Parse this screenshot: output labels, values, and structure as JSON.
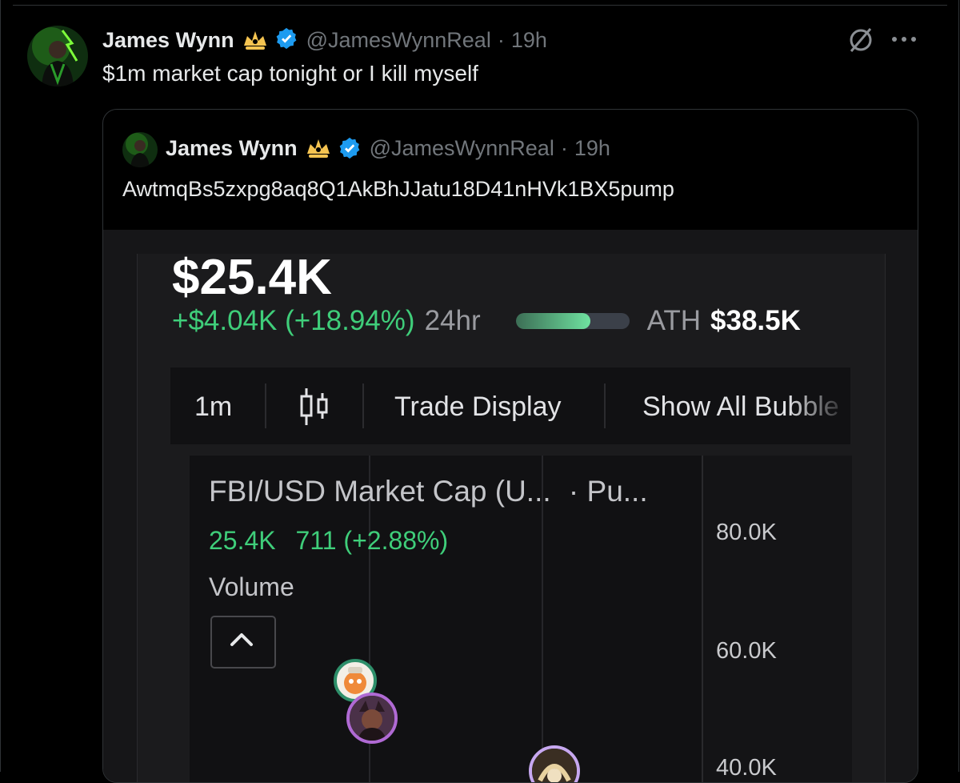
{
  "tweet": {
    "author_name": "James Wynn",
    "handle": "@JamesWynnReal",
    "dot": "·",
    "time": "19h",
    "text": "$1m market cap tonight or I kill myself",
    "more_icon": "more-horizontal-icon",
    "grok_icon": "grok-slash-icon"
  },
  "quoted": {
    "author_name": "James Wynn",
    "handle": "@JamesWynnReal",
    "dot": "·",
    "time": "19h",
    "text": "AwtmqBs5zxpg8aq8Q1AkBhJJatu18D41nHVk1BX5pump"
  },
  "token_screen": {
    "market_cap": "$25.4K",
    "change": "+$4.04K (+18.94%)",
    "period": "24hr",
    "ath_label": "ATH",
    "ath_value": "$38.5K",
    "ath_progress": 0.66,
    "toolbar": {
      "interval": "1m",
      "candle_icon": "candlestick-icon",
      "trade_display": "Trade Display",
      "show_bubbles": "Show All Bubble"
    },
    "chart": {
      "title": "FBI/USD Market Cap (U...",
      "title_suffix": "· Pu...",
      "last_value": "25.4K",
      "change": "711 (+2.88%)",
      "volume_label": "Volume",
      "y_ticks": [
        "80.0K",
        "60.0K",
        "40.0K"
      ]
    },
    "colors": {
      "green": "#3fce7a",
      "background": "#111113"
    }
  }
}
